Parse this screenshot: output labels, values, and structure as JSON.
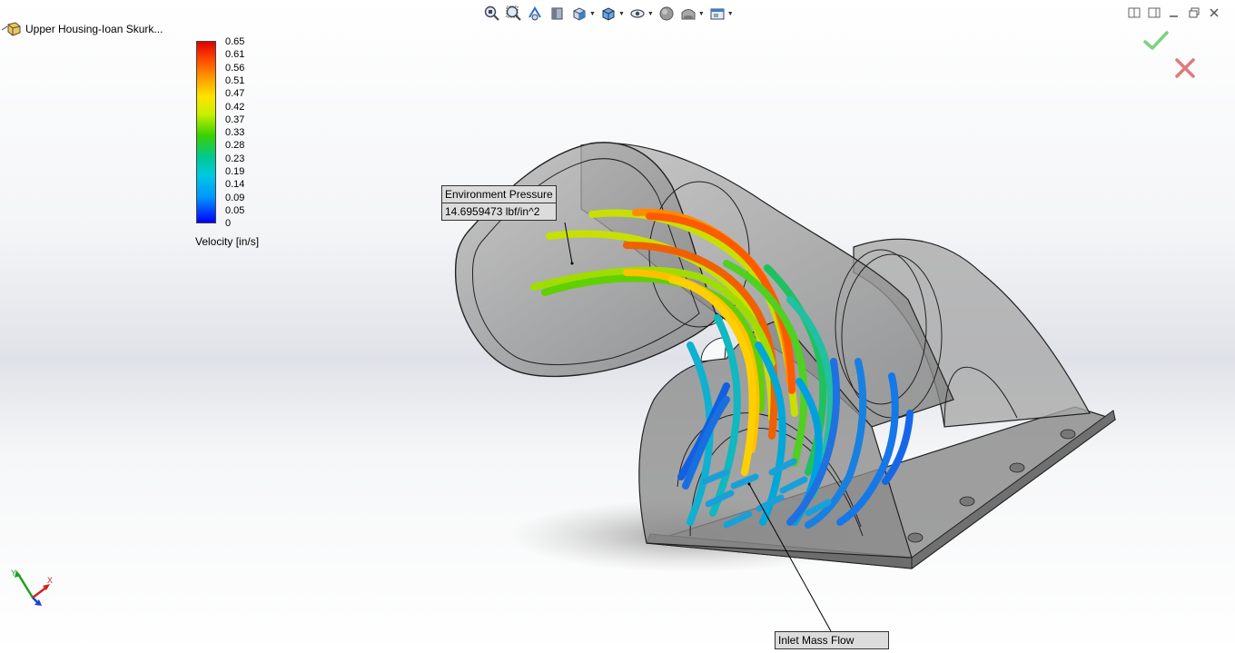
{
  "feature_tree": {
    "root_label": "Upper Housing-Ioan Skurk...",
    "root_icon": "part-icon"
  },
  "heads_up_toolbar": [
    {
      "name": "zoom-to-fit",
      "icon": "zoom-to-fit-icon",
      "dropdown": false
    },
    {
      "name": "zoom-to-area",
      "icon": "zoom-to-area-icon",
      "dropdown": false
    },
    {
      "name": "previous-view",
      "icon": "previous-view-icon",
      "dropdown": false
    },
    {
      "name": "section-view",
      "icon": "section-view-icon",
      "dropdown": false
    },
    {
      "name": "view-orientation",
      "icon": "view-orientation-icon",
      "dropdown": true
    },
    {
      "name": "display-style",
      "icon": "display-style-icon",
      "dropdown": true
    },
    {
      "name": "hide-show-items",
      "icon": "hide-show-items-icon",
      "dropdown": true
    },
    {
      "name": "edit-appearance",
      "icon": "edit-appearance-icon",
      "dropdown": false
    },
    {
      "name": "apply-scene",
      "icon": "apply-scene-icon",
      "dropdown": true
    },
    {
      "name": "view-settings",
      "icon": "view-settings-icon",
      "dropdown": true
    }
  ],
  "window_controls": [
    "tile-horizontal-icon",
    "tile-vertical-icon",
    "minimize-icon",
    "restore-icon",
    "close-icon"
  ],
  "confirmation_corner": {
    "ok_icon": "check-icon",
    "cancel_icon": "x-icon",
    "ok_color": "#7fd17f",
    "cancel_color": "#e07a7a"
  },
  "legend": {
    "title": "Velocity [in/s]",
    "ticks": [
      "0.65",
      "0.61",
      "0.56",
      "0.51",
      "0.47",
      "0.42",
      "0.37",
      "0.33",
      "0.28",
      "0.23",
      "0.19",
      "0.14",
      "0.09",
      "0.05",
      "0"
    ]
  },
  "callouts": {
    "environment_pressure": {
      "title": "Environment Pressure",
      "value": "14.6959473 lbf/in^2"
    },
    "inlet_mass_flow": {
      "title": "Inlet Mass Flow"
    }
  },
  "triad": {
    "x_label": "X",
    "y_label": "Y",
    "x_color": "#d02020",
    "y_color": "#20a020",
    "z_color": "#2040d0"
  },
  "colors": {
    "max_velocity": "#e00000",
    "min_velocity": "#0000ff",
    "housing_fill": "#8c8c8c"
  }
}
